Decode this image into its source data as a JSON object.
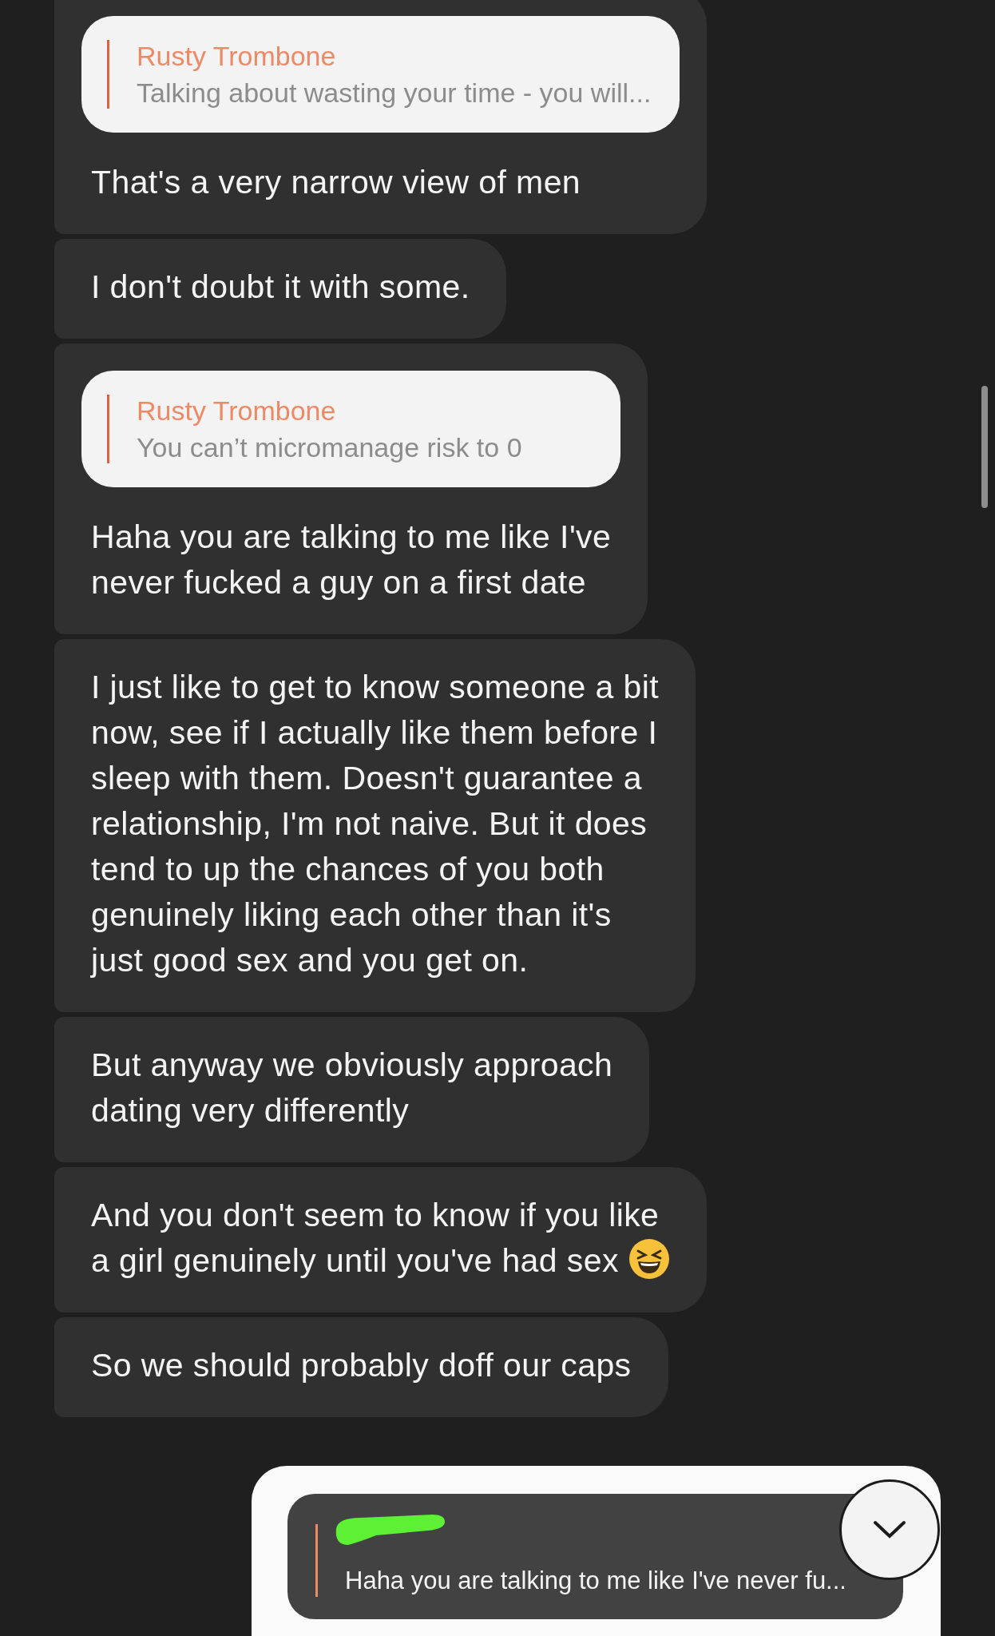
{
  "messages": [
    {
      "quote": {
        "author": "Rusty Trombone",
        "text": "Talking about wasting your time - you will..."
      },
      "lines": [
        "That's a very narrow view of men"
      ]
    },
    {
      "lines": [
        "I don't doubt it with some."
      ]
    },
    {
      "quote": {
        "author": "Rusty Trombone",
        "text": "You can’t micromanage risk to 0"
      },
      "lines": [
        "Haha you are talking to me like I've",
        "never fucked a guy on a first date"
      ]
    },
    {
      "lines": [
        "I just like to get to know someone a bit",
        "now, see if I actually like them before I",
        "sleep with them. Doesn't guarantee a",
        "relationship, I'm not naive. But it does",
        "tend to up the chances of you both",
        "genuinely liking each other than it's",
        "just good sex and you get on."
      ]
    },
    {
      "lines": [
        "But anyway we obviously approach",
        "dating very differently"
      ]
    },
    {
      "lines": [
        "And you don't seem to know if you like",
        "a girl genuinely until you've had sex"
      ],
      "ends_with_emoji": true
    },
    {
      "lines": [
        "So we should probably doff our caps"
      ]
    }
  ],
  "composer": {
    "reply_preview": {
      "author_redacted": true,
      "text": "Haha you are talking to me like I've never fu..."
    }
  }
}
